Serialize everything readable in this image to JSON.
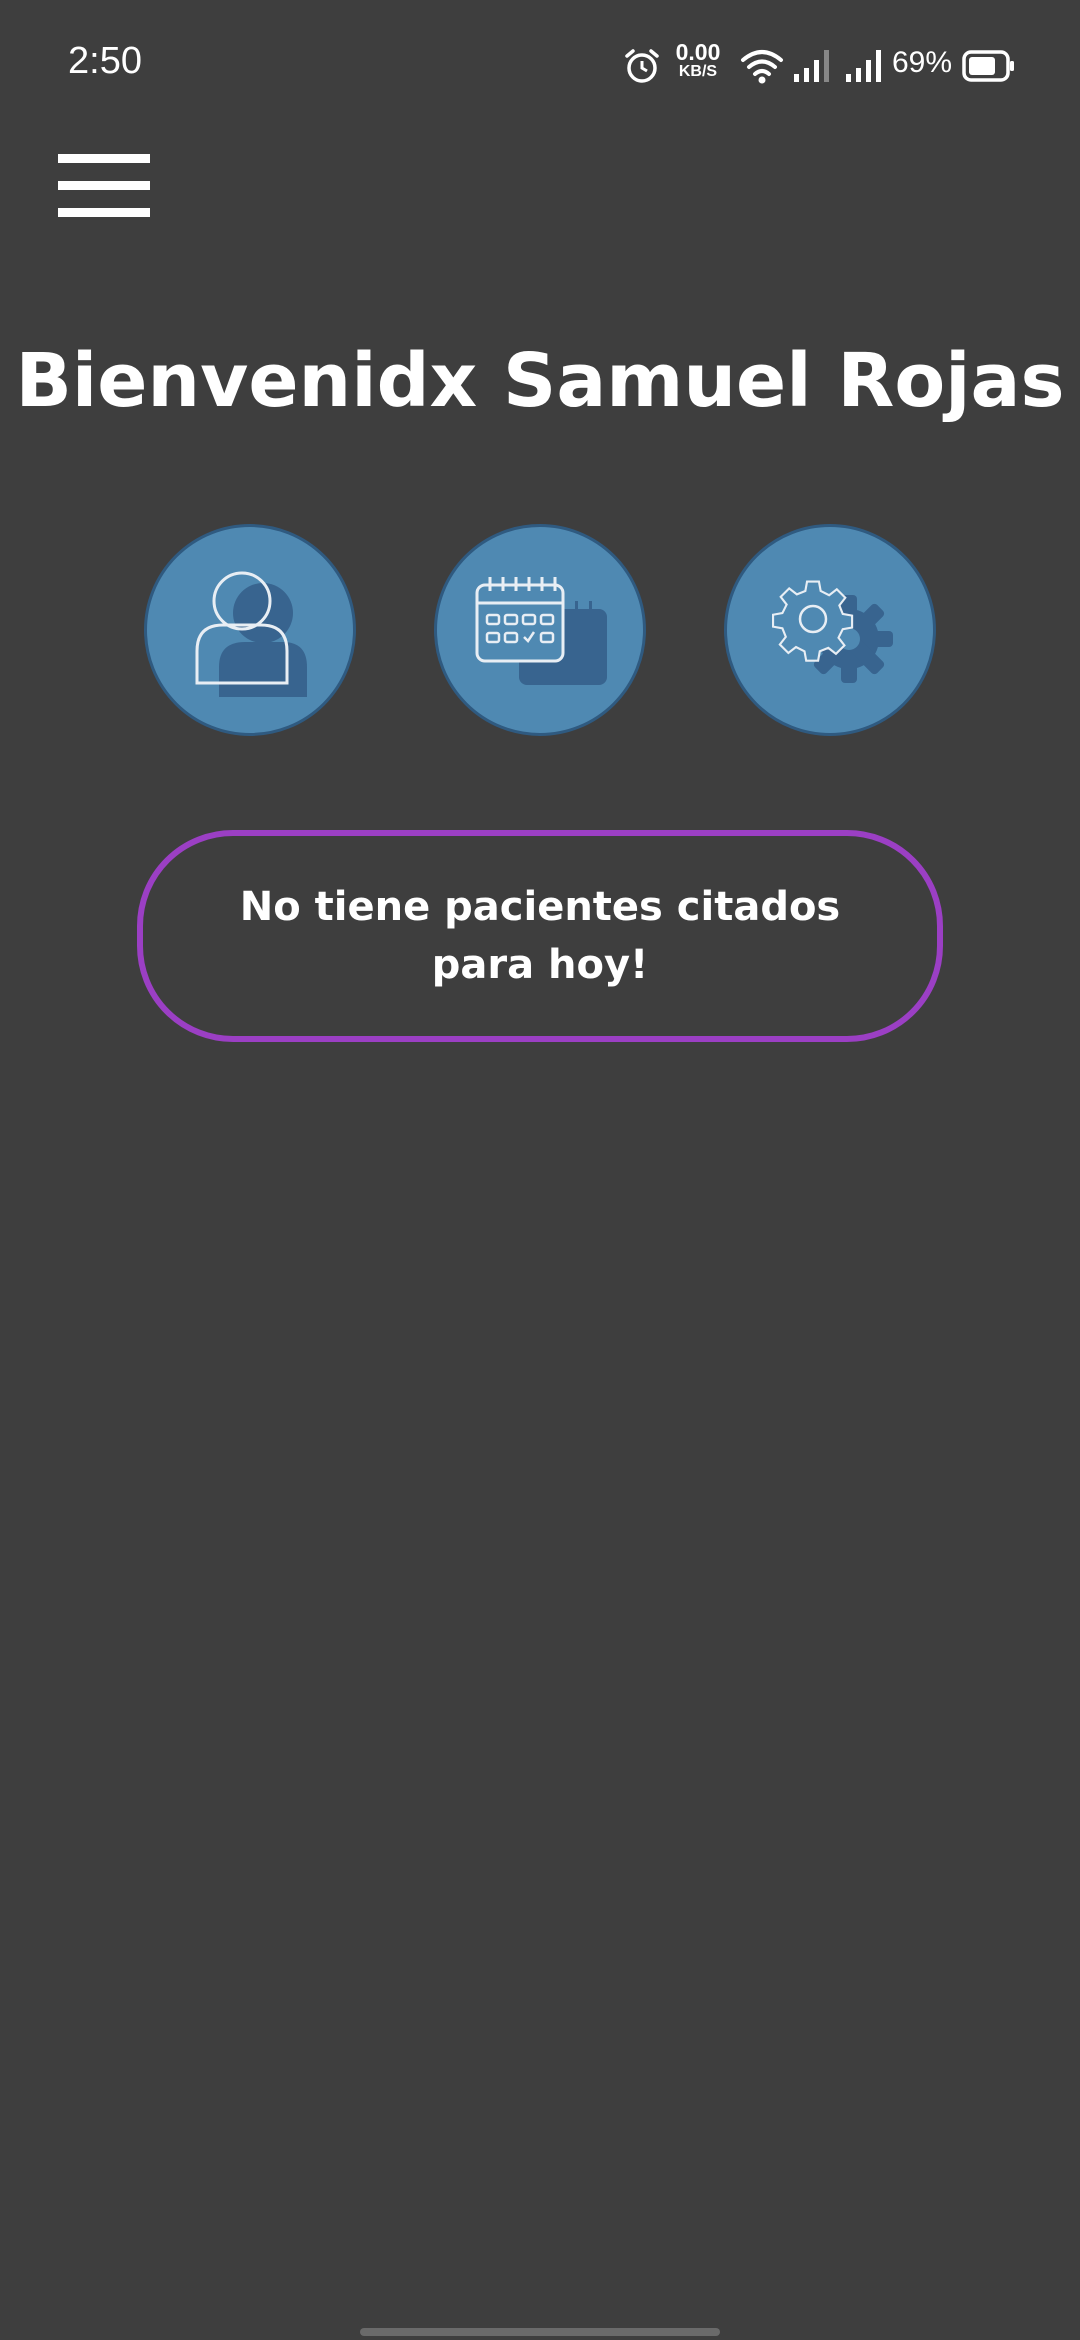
{
  "status_bar": {
    "time": "2:50",
    "net_speed_value": "0.00",
    "net_speed_unit": "KB/S",
    "battery_percent": "69%",
    "icons": [
      "alarm-icon",
      "wifi-icon",
      "signal-icon",
      "signal-icon",
      "battery-icon"
    ]
  },
  "header": {
    "menu_icon": "hamburger-menu-icon"
  },
  "main": {
    "welcome_title": "Bienvenidx Samuel Rojas",
    "action_buttons": [
      {
        "icon": "patients-icon"
      },
      {
        "icon": "calendar-icon"
      },
      {
        "icon": "settings-icon"
      }
    ],
    "notice": "No tiene pacientes citados para hoy!"
  },
  "colors": {
    "background": "#3e3e3e",
    "circle_fill": "#4f89b2",
    "circle_border": "#2f5a80",
    "notice_border": "#9b3fc4"
  }
}
